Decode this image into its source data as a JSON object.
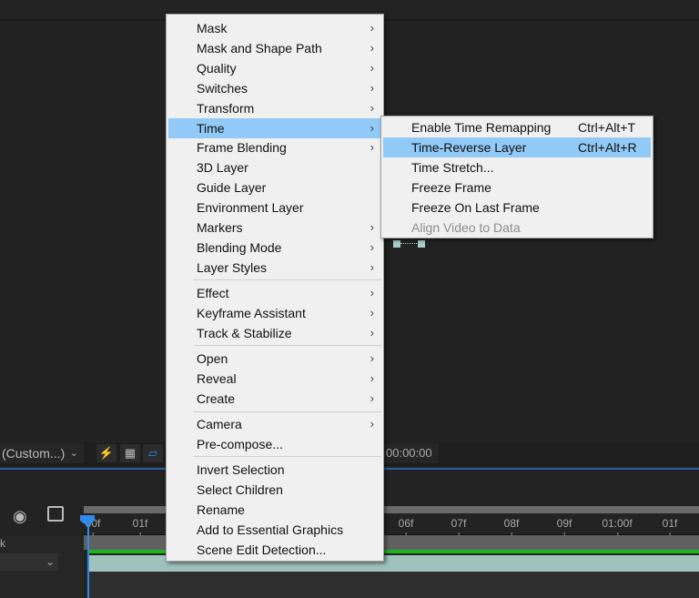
{
  "colors": {
    "highlight": "#91c9f7",
    "accent_blue": "#2d8ceb",
    "layer_bar": "#9fc2bc",
    "green_bar": "#1db41d"
  },
  "toolbar": {
    "resolution": "(Custom...)",
    "timecode": "00:00:00",
    "icons": [
      "fast-previews-icon",
      "transparency-grid-icon",
      "mask-visibility-icon"
    ]
  },
  "timeline": {
    "ticks": [
      "00f",
      "01f",
      "06f",
      "07f",
      "08f",
      "09f",
      "01:00f",
      "01f"
    ],
    "left_label": "k"
  },
  "context_menu": {
    "items": [
      {
        "label": "Mask",
        "submenu": true
      },
      {
        "label": "Mask and Shape Path",
        "submenu": true
      },
      {
        "label": "Quality",
        "submenu": true
      },
      {
        "label": "Switches",
        "submenu": true
      },
      {
        "label": "Transform",
        "submenu": true
      },
      {
        "label": "Time",
        "submenu": true,
        "highlighted": true
      },
      {
        "label": "Frame Blending",
        "submenu": true
      },
      {
        "label": "3D Layer"
      },
      {
        "label": "Guide Layer"
      },
      {
        "label": "Environment Layer"
      },
      {
        "label": "Markers",
        "submenu": true
      },
      {
        "label": "Blending Mode",
        "submenu": true
      },
      {
        "label": "Layer Styles",
        "submenu": true
      },
      {
        "label": "Effect",
        "submenu": true
      },
      {
        "label": "Keyframe Assistant",
        "submenu": true
      },
      {
        "label": "Track & Stabilize",
        "submenu": true
      },
      {
        "label": "Open",
        "submenu": true
      },
      {
        "label": "Reveal",
        "submenu": true
      },
      {
        "label": "Create",
        "submenu": true
      },
      {
        "label": "Camera",
        "submenu": true
      },
      {
        "label": "Pre-compose..."
      },
      {
        "label": "Invert Selection"
      },
      {
        "label": "Select Children"
      },
      {
        "label": "Rename"
      },
      {
        "label": "Add to Essential Graphics"
      },
      {
        "label": "Scene Edit Detection..."
      }
    ]
  },
  "time_submenu": {
    "items": [
      {
        "label": "Enable Time Remapping",
        "shortcut": "Ctrl+Alt+T"
      },
      {
        "label": "Time-Reverse Layer",
        "shortcut": "Ctrl+Alt+R",
        "highlighted": true
      },
      {
        "label": "Time Stretch..."
      },
      {
        "label": "Freeze Frame"
      },
      {
        "label": "Freeze On Last Frame"
      },
      {
        "label": "Align Video to Data",
        "disabled": true
      }
    ]
  }
}
